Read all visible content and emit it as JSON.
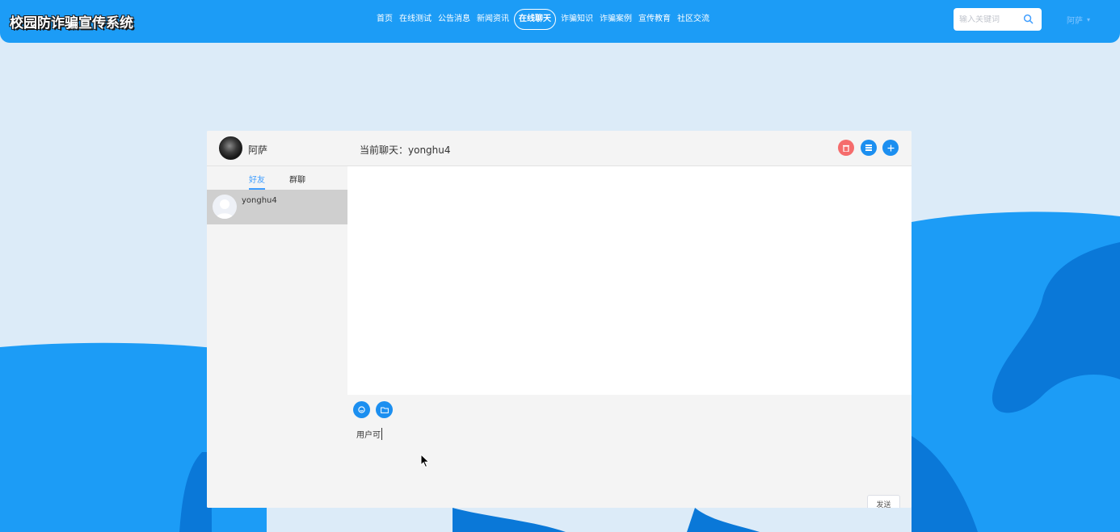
{
  "header": {
    "logo": "校园防诈骗宣传系统",
    "nav": [
      "首页",
      "在线测试",
      "公告消息",
      "新闻资讯",
      "在线聊天",
      "诈骗知识",
      "诈骗案例",
      "宣传教育",
      "社区交流"
    ],
    "active_nav": "在线聊天",
    "search_placeholder": "输入关键词",
    "user_name": "阿萨",
    "caret": "▾"
  },
  "chat": {
    "me_name": "阿萨",
    "current_chat": "当前聊天：yonghu4",
    "tabs": {
      "friends": "好友",
      "groups": "群聊"
    },
    "friends": [
      {
        "name": "yonghu4"
      }
    ],
    "input_text": "用户可",
    "send_label": "发送"
  },
  "colors": {
    "primary": "#1c9cf6",
    "danger": "#f56c6c",
    "tab_active": "#409eff",
    "background": "#dcebf8"
  }
}
